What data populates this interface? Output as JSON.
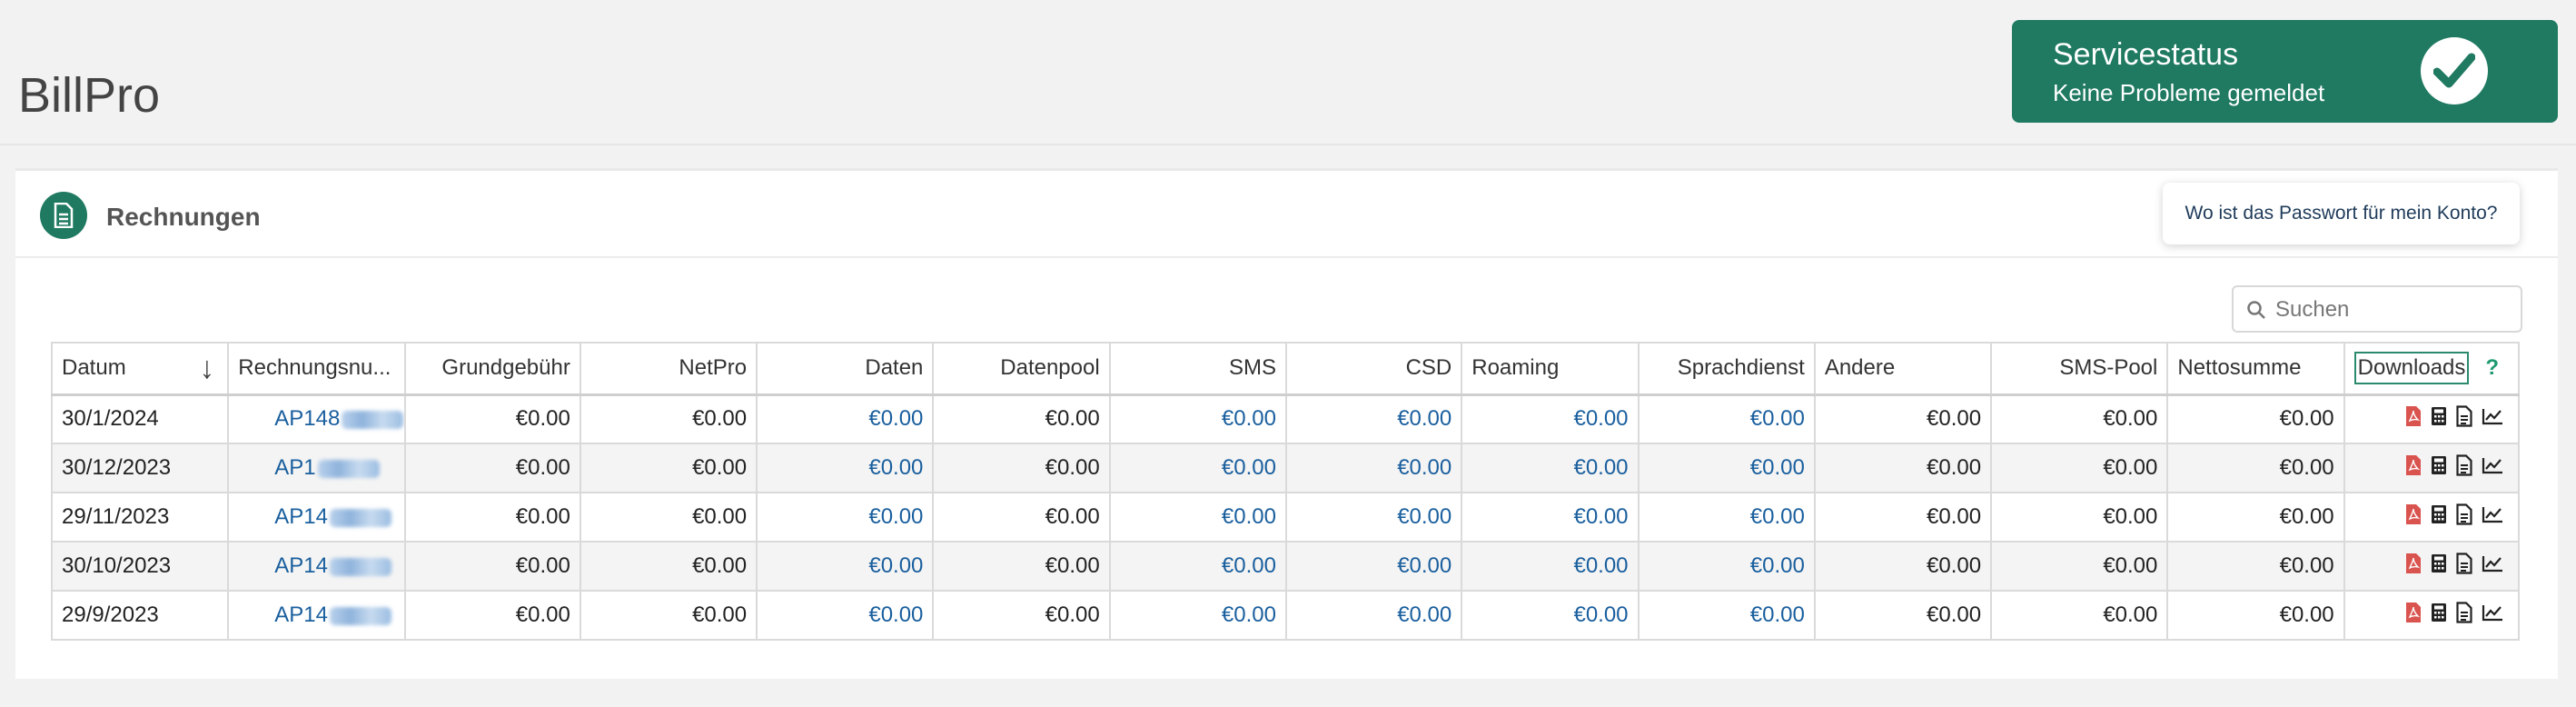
{
  "app": {
    "title": "BillPro"
  },
  "service_status": {
    "title": "Servicestatus",
    "message": "Keine Probleme gemeldet",
    "icon": "check-circle-icon",
    "color": "#1f7a61"
  },
  "panel": {
    "title": "Rechnungen",
    "icon": "document-icon",
    "password_help": "Wo ist das Passwort für mein Konto?",
    "search_placeholder": "Suchen"
  },
  "table": {
    "columns": [
      "Datum",
      "Rechnungsnu...",
      "Grundgebühr",
      "NetPro",
      "Daten",
      "Datenpool",
      "SMS",
      "CSD",
      "Roaming",
      "Sprachdienst",
      "Andere",
      "SMS-Pool",
      "Nettosumme",
      "Downloads"
    ],
    "help_marker": "?",
    "rows": [
      {
        "datum": "30/1/2024",
        "nummer": "AP148",
        "grund": "€0.00",
        "netpro": "€0.00",
        "daten": "€0.00",
        "datenpool": "€0.00",
        "sms": "€0.00",
        "csd": "€0.00",
        "roaming": "€0.00",
        "sprach": "€0.00",
        "andere": "€0.00",
        "smspool": "€0.00",
        "netto": "€0.00"
      },
      {
        "datum": "30/12/2023",
        "nummer": "AP1",
        "grund": "€0.00",
        "netpro": "€0.00",
        "daten": "€0.00",
        "datenpool": "€0.00",
        "sms": "€0.00",
        "csd": "€0.00",
        "roaming": "€0.00",
        "sprach": "€0.00",
        "andere": "€0.00",
        "smspool": "€0.00",
        "netto": "€0.00"
      },
      {
        "datum": "29/11/2023",
        "nummer": "AP14",
        "grund": "€0.00",
        "netpro": "€0.00",
        "daten": "€0.00",
        "datenpool": "€0.00",
        "sms": "€0.00",
        "csd": "€0.00",
        "roaming": "€0.00",
        "sprach": "€0.00",
        "andere": "€0.00",
        "smspool": "€0.00",
        "netto": "€0.00"
      },
      {
        "datum": "30/10/2023",
        "nummer": "AP14",
        "grund": "€0.00",
        "netpro": "€0.00",
        "daten": "€0.00",
        "datenpool": "€0.00",
        "sms": "€0.00",
        "csd": "€0.00",
        "roaming": "€0.00",
        "sprach": "€0.00",
        "andere": "€0.00",
        "smspool": "€0.00",
        "netto": "€0.00"
      },
      {
        "datum": "29/9/2023",
        "nummer": "AP14",
        "grund": "€0.00",
        "netpro": "€0.00",
        "daten": "€0.00",
        "datenpool": "€0.00",
        "sms": "€0.00",
        "csd": "€0.00",
        "roaming": "€0.00",
        "sprach": "€0.00",
        "andere": "€0.00",
        "smspool": "€0.00",
        "netto": "€0.00"
      }
    ],
    "download_icons": [
      "pdf-icon",
      "calculator-icon",
      "file-text-icon",
      "line-chart-icon"
    ]
  },
  "colors": {
    "accent": "#1f7a61",
    "link": "#1a5f9e",
    "pdf": "#d9534f"
  }
}
